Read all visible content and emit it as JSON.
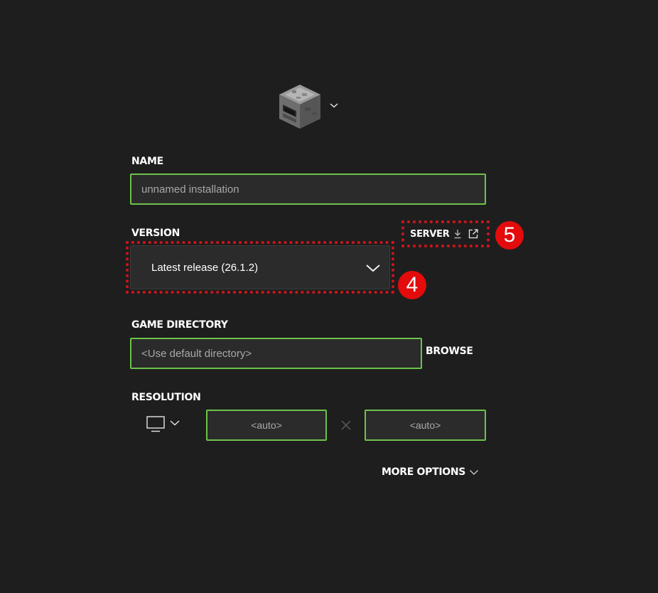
{
  "installation": {
    "icon": "furnace-block-icon",
    "name_label": "NAME",
    "name_placeholder": "unnamed installation",
    "version_label": "VERSION",
    "version_value": "Latest release (26.1.2)",
    "server_label": "SERVER",
    "gamedir_label": "GAME DIRECTORY",
    "gamedir_placeholder": "<Use default directory>",
    "browse_label": "BROWSE",
    "resolution_label": "RESOLUTION",
    "res_width_placeholder": "<auto>",
    "res_height_placeholder": "<auto>",
    "more_options_label": "MORE OPTIONS"
  },
  "annotations": {
    "version_badge": "4",
    "server_badge": "5",
    "highlight_color": "#d3141b",
    "badge_color": "#e30b0b"
  },
  "colors": {
    "background": "#1e1e1e",
    "field_border": "#6cc349",
    "field_bg": "#2b2b2b"
  }
}
